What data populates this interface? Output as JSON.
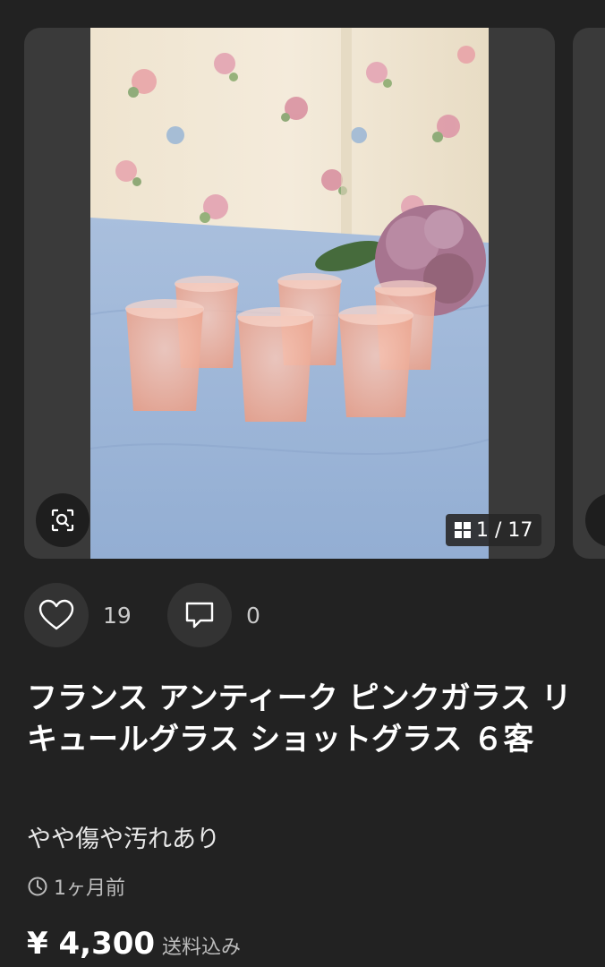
{
  "image_carousel": {
    "counter_text": "1 / 17",
    "photo_alt": "フランス アンティーク ピンクガラス リキュールグラス ショットグラス 6客",
    "zoom_icon": "zoom-search-icon",
    "grid_icon": "grid-icon"
  },
  "actions": {
    "likes_count": "19",
    "comments_count": "0",
    "like_icon": "heart-icon",
    "comment_icon": "comment-icon"
  },
  "item": {
    "title": "フランス アンティーク ピンクガラス リキュールグラス ショットグラス ６客",
    "condition": "やや傷や汚れあり",
    "posted": "1ヶ月前",
    "price": "¥ 4,300",
    "shipping_note": "送料込み"
  }
}
